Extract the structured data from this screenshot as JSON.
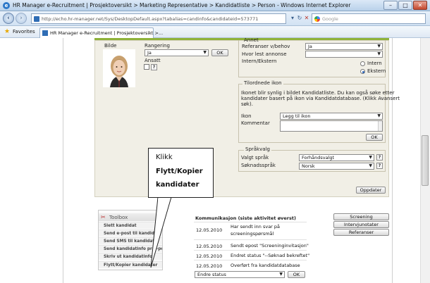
{
  "window": {
    "title": "HR Manager e-Recruitment | Prosjektoversikt > Marketing Representative > Kandidatliste > Person - Windows Internet Explorer",
    "min": "–",
    "max": "□",
    "close": "✕"
  },
  "browser": {
    "url": "http://echo.hr-manager.net/Sys/DesktopDefault.aspx?tabalias=candinfo&candidateid=573771",
    "search_placeholder": "Google",
    "favorites_label": "Favorites",
    "tab_label": "HR Manager e-Recruitment | Prosjektoversikt >..."
  },
  "candidate": {
    "photo_label": "Bilde",
    "rating_label": "Rangering",
    "rating_value": "Ja",
    "ok_label": "OK",
    "employed_label": "Ansatt",
    "help": "?"
  },
  "annet": {
    "legend": "Annet",
    "references_label": "Referanser v/behov",
    "references_value": "Ja",
    "ad_read_label": "Hvor lest annonse",
    "ad_read_value": "",
    "internal_external_label": "Intern/Ekstern",
    "radio_intern": "Intern",
    "radio_ekstern": "Ekstern"
  },
  "icon_section": {
    "legend": "Tilordnede ikon",
    "description": [
      "Ikonet blir synlig i bildet Kandidatliste. Du kan også søke etter",
      "kandidater basert på ikon via Kandidatdatabase. (Klikk Avansert",
      "søk)."
    ],
    "icon_label": "Ikon",
    "icon_value": "Legg til ikon",
    "comment_label": "Kommentar",
    "ok_label": "OK"
  },
  "language": {
    "legend": "Språkvalg",
    "chosen_label": "Valgt språk",
    "chosen_value": "Forhåndsvalgt",
    "application_label": "Søknadsspråk",
    "application_value": "Norsk"
  },
  "update_button": "Oppdater",
  "toolbox": {
    "title": "Toolbox",
    "items": [
      "Slett kandidat",
      "Send e-post til kandidat",
      "Send SMS til kandidat",
      "Send kandidatinfo pr e-post",
      "Skriv ut kandidatinfo",
      "Flytt/Kopier kandidater"
    ]
  },
  "communication": {
    "header": "Kommunikasjon (siste aktivitet øverst)",
    "rows": [
      {
        "date": "12.05.2010",
        "text": [
          "Har sendt inn svar på",
          "screeningspørsmål"
        ]
      },
      {
        "date": "12.05.2010",
        "text": [
          "Sendt epost \"Screeninginvitasjon\""
        ]
      },
      {
        "date": "12.05.2010",
        "text": [
          "Endret status \"--Søknad bekreftet\""
        ]
      },
      {
        "date": "12.05.2010",
        "text": [
          "Overført fra kandidatdatabase"
        ]
      }
    ],
    "status_value": "Endre status",
    "ok_label": "OK"
  },
  "side_buttons": [
    "Screening",
    "Intervjunotater",
    "Referanser"
  ],
  "callout": {
    "line1": "Klikk",
    "line2": "Flytt/Kopier",
    "line3": "kandidater"
  }
}
